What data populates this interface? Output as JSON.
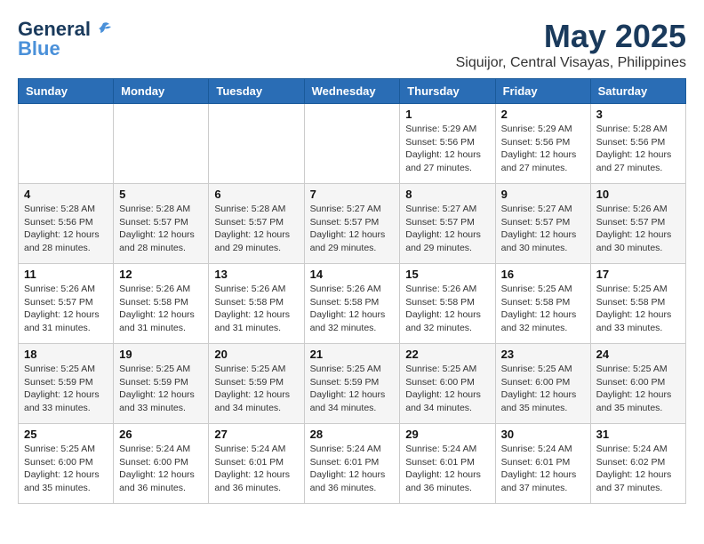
{
  "header": {
    "logo_general": "General",
    "logo_blue": "Blue",
    "month_title": "May 2025",
    "location": "Siquijor, Central Visayas, Philippines"
  },
  "weekdays": [
    "Sunday",
    "Monday",
    "Tuesday",
    "Wednesday",
    "Thursday",
    "Friday",
    "Saturday"
  ],
  "weeks": [
    [
      {
        "day": "",
        "info": ""
      },
      {
        "day": "",
        "info": ""
      },
      {
        "day": "",
        "info": ""
      },
      {
        "day": "",
        "info": ""
      },
      {
        "day": "1",
        "info": "Sunrise: 5:29 AM\nSunset: 5:56 PM\nDaylight: 12 hours and 27 minutes."
      },
      {
        "day": "2",
        "info": "Sunrise: 5:29 AM\nSunset: 5:56 PM\nDaylight: 12 hours and 27 minutes."
      },
      {
        "day": "3",
        "info": "Sunrise: 5:28 AM\nSunset: 5:56 PM\nDaylight: 12 hours and 27 minutes."
      }
    ],
    [
      {
        "day": "4",
        "info": "Sunrise: 5:28 AM\nSunset: 5:56 PM\nDaylight: 12 hours and 28 minutes."
      },
      {
        "day": "5",
        "info": "Sunrise: 5:28 AM\nSunset: 5:57 PM\nDaylight: 12 hours and 28 minutes."
      },
      {
        "day": "6",
        "info": "Sunrise: 5:28 AM\nSunset: 5:57 PM\nDaylight: 12 hours and 29 minutes."
      },
      {
        "day": "7",
        "info": "Sunrise: 5:27 AM\nSunset: 5:57 PM\nDaylight: 12 hours and 29 minutes."
      },
      {
        "day": "8",
        "info": "Sunrise: 5:27 AM\nSunset: 5:57 PM\nDaylight: 12 hours and 29 minutes."
      },
      {
        "day": "9",
        "info": "Sunrise: 5:27 AM\nSunset: 5:57 PM\nDaylight: 12 hours and 30 minutes."
      },
      {
        "day": "10",
        "info": "Sunrise: 5:26 AM\nSunset: 5:57 PM\nDaylight: 12 hours and 30 minutes."
      }
    ],
    [
      {
        "day": "11",
        "info": "Sunrise: 5:26 AM\nSunset: 5:57 PM\nDaylight: 12 hours and 31 minutes."
      },
      {
        "day": "12",
        "info": "Sunrise: 5:26 AM\nSunset: 5:58 PM\nDaylight: 12 hours and 31 minutes."
      },
      {
        "day": "13",
        "info": "Sunrise: 5:26 AM\nSunset: 5:58 PM\nDaylight: 12 hours and 31 minutes."
      },
      {
        "day": "14",
        "info": "Sunrise: 5:26 AM\nSunset: 5:58 PM\nDaylight: 12 hours and 32 minutes."
      },
      {
        "day": "15",
        "info": "Sunrise: 5:26 AM\nSunset: 5:58 PM\nDaylight: 12 hours and 32 minutes."
      },
      {
        "day": "16",
        "info": "Sunrise: 5:25 AM\nSunset: 5:58 PM\nDaylight: 12 hours and 32 minutes."
      },
      {
        "day": "17",
        "info": "Sunrise: 5:25 AM\nSunset: 5:58 PM\nDaylight: 12 hours and 33 minutes."
      }
    ],
    [
      {
        "day": "18",
        "info": "Sunrise: 5:25 AM\nSunset: 5:59 PM\nDaylight: 12 hours and 33 minutes."
      },
      {
        "day": "19",
        "info": "Sunrise: 5:25 AM\nSunset: 5:59 PM\nDaylight: 12 hours and 33 minutes."
      },
      {
        "day": "20",
        "info": "Sunrise: 5:25 AM\nSunset: 5:59 PM\nDaylight: 12 hours and 34 minutes."
      },
      {
        "day": "21",
        "info": "Sunrise: 5:25 AM\nSunset: 5:59 PM\nDaylight: 12 hours and 34 minutes."
      },
      {
        "day": "22",
        "info": "Sunrise: 5:25 AM\nSunset: 6:00 PM\nDaylight: 12 hours and 34 minutes."
      },
      {
        "day": "23",
        "info": "Sunrise: 5:25 AM\nSunset: 6:00 PM\nDaylight: 12 hours and 35 minutes."
      },
      {
        "day": "24",
        "info": "Sunrise: 5:25 AM\nSunset: 6:00 PM\nDaylight: 12 hours and 35 minutes."
      }
    ],
    [
      {
        "day": "25",
        "info": "Sunrise: 5:25 AM\nSunset: 6:00 PM\nDaylight: 12 hours and 35 minutes."
      },
      {
        "day": "26",
        "info": "Sunrise: 5:24 AM\nSunset: 6:00 PM\nDaylight: 12 hours and 36 minutes."
      },
      {
        "day": "27",
        "info": "Sunrise: 5:24 AM\nSunset: 6:01 PM\nDaylight: 12 hours and 36 minutes."
      },
      {
        "day": "28",
        "info": "Sunrise: 5:24 AM\nSunset: 6:01 PM\nDaylight: 12 hours and 36 minutes."
      },
      {
        "day": "29",
        "info": "Sunrise: 5:24 AM\nSunset: 6:01 PM\nDaylight: 12 hours and 36 minutes."
      },
      {
        "day": "30",
        "info": "Sunrise: 5:24 AM\nSunset: 6:01 PM\nDaylight: 12 hours and 37 minutes."
      },
      {
        "day": "31",
        "info": "Sunrise: 5:24 AM\nSunset: 6:02 PM\nDaylight: 12 hours and 37 minutes."
      }
    ]
  ]
}
